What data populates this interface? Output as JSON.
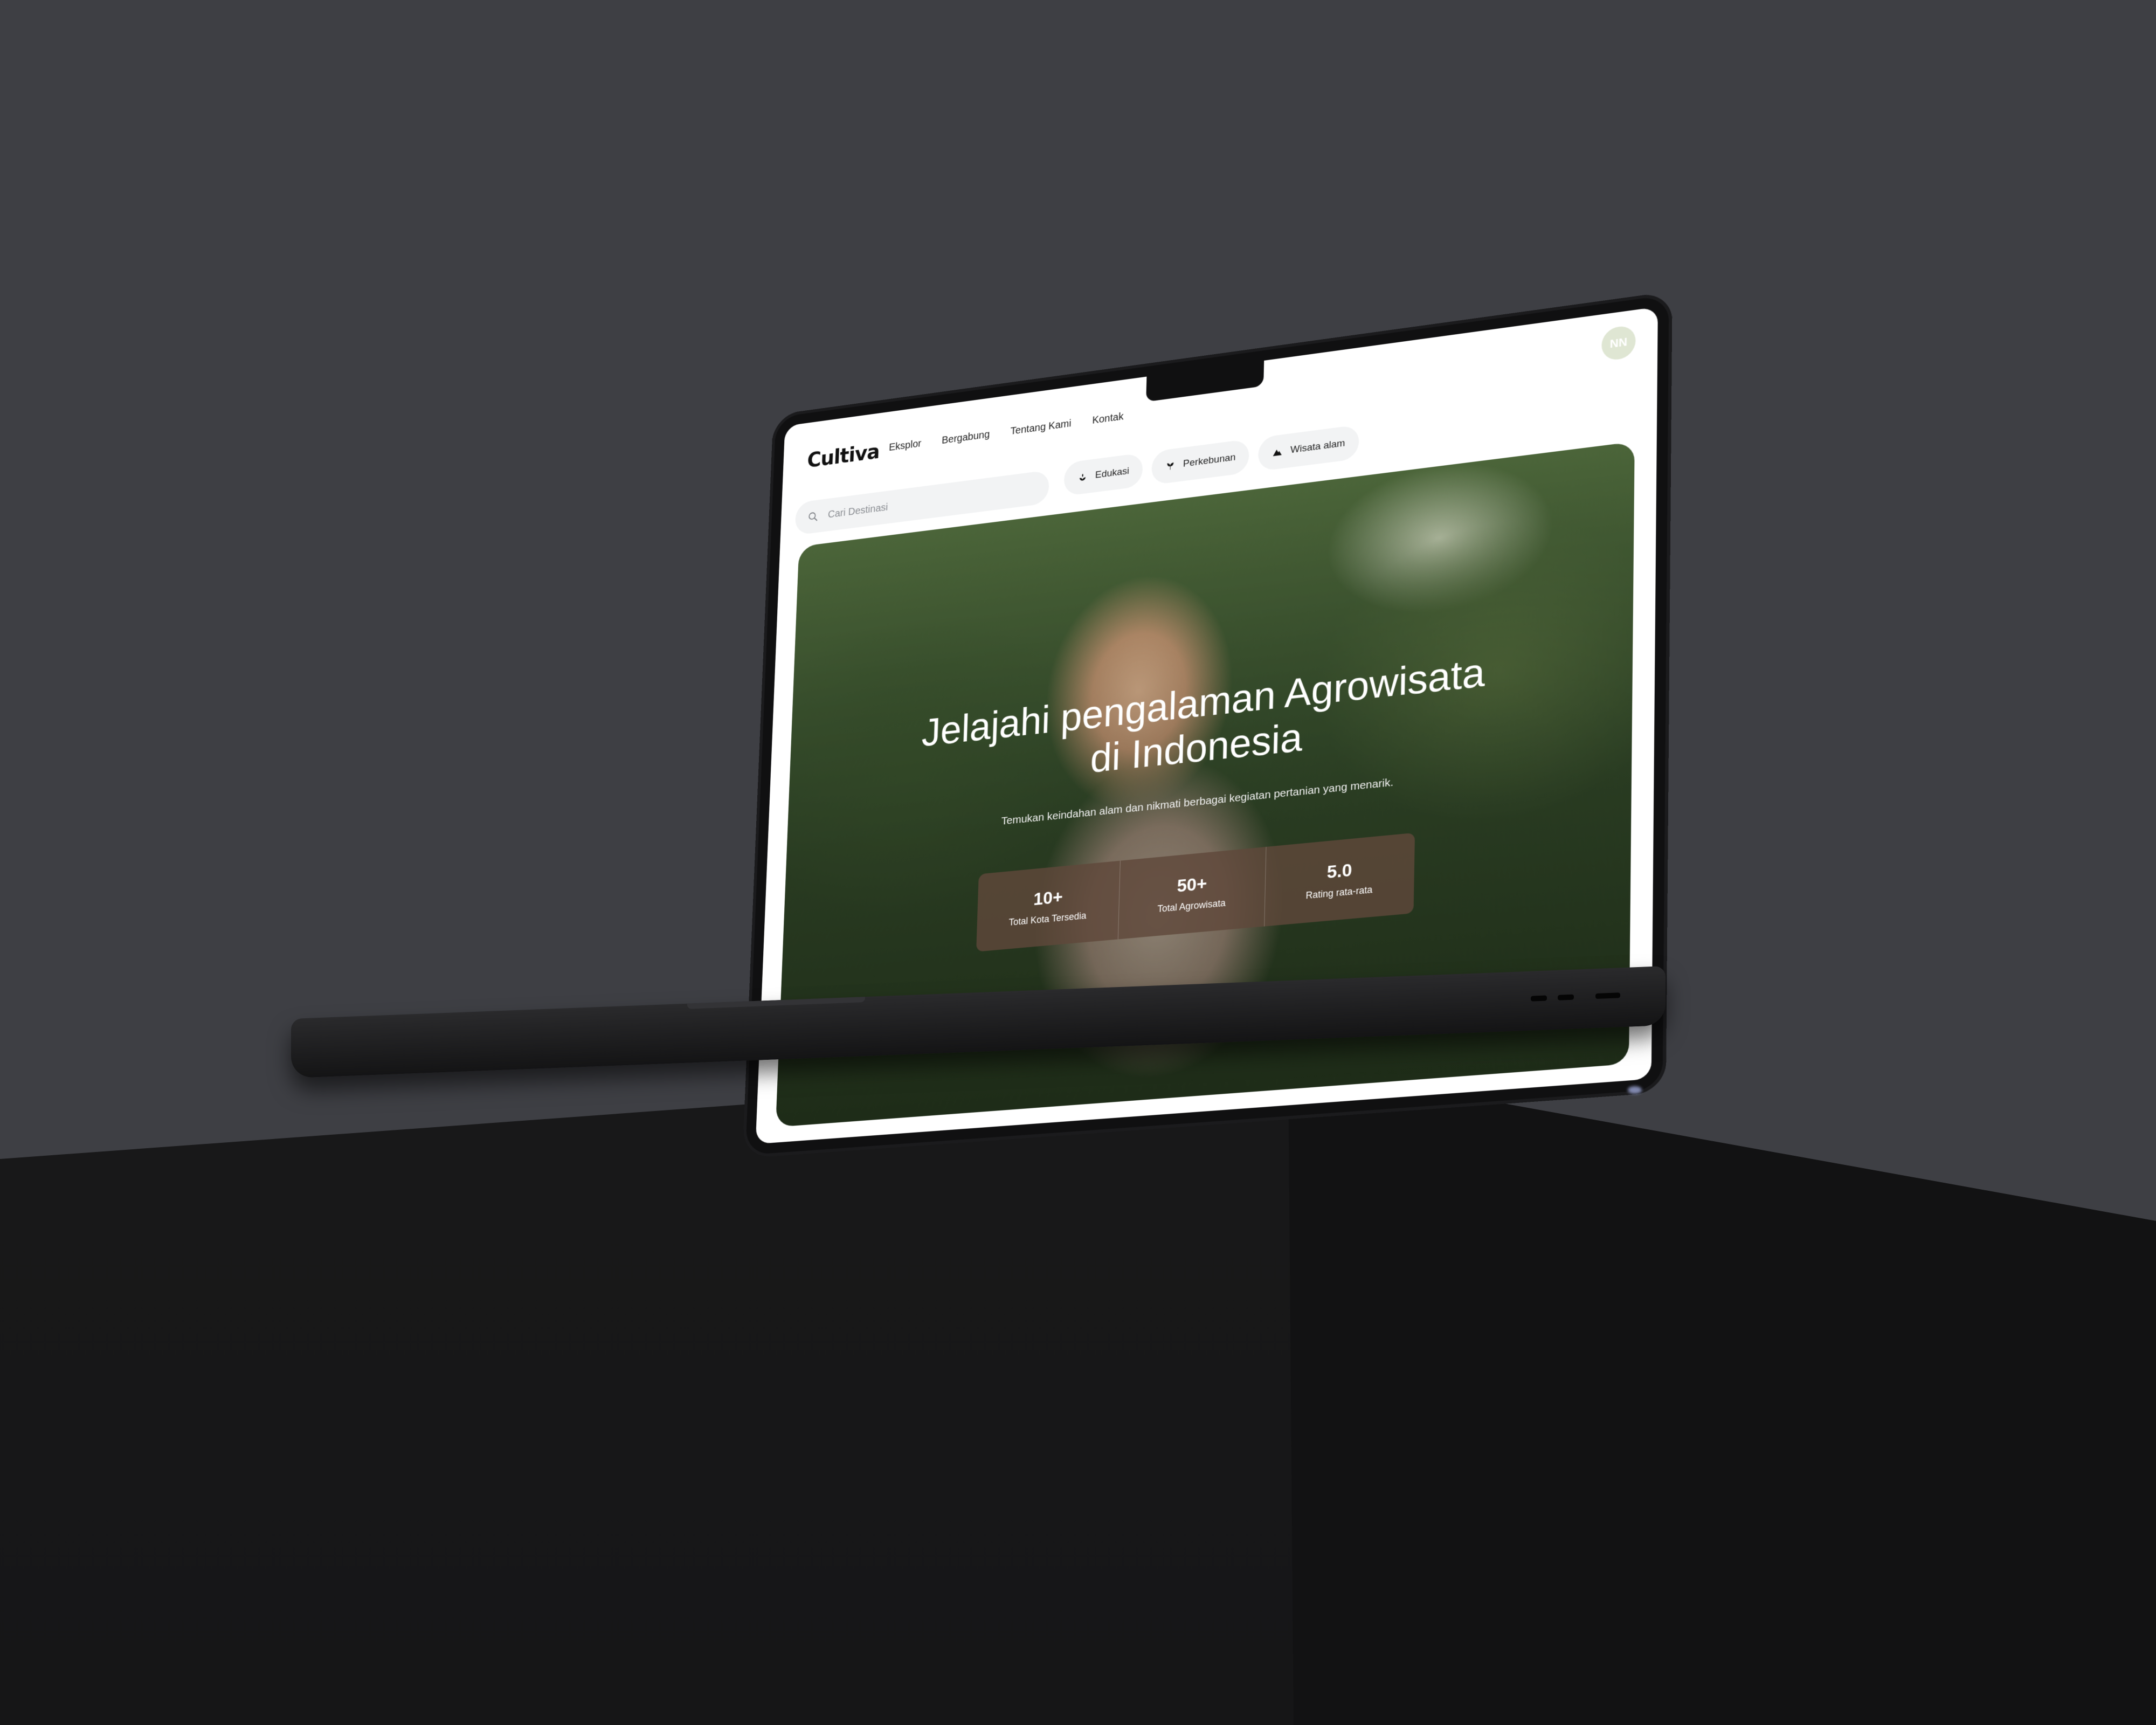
{
  "app": {
    "logo": "Cultiva"
  },
  "nav": {
    "items": [
      {
        "label": "Eksplor"
      },
      {
        "label": "Bergabung"
      },
      {
        "label": "Tentang Kami"
      },
      {
        "label": "Kontak"
      }
    ],
    "avatar_initials": "NN"
  },
  "search": {
    "placeholder": "Cari Destinasi",
    "icon": "search-icon"
  },
  "categories": [
    {
      "label": "Edukasi",
      "icon": "plant-icon"
    },
    {
      "label": "Perkebunan",
      "icon": "sprout-icon"
    },
    {
      "label": "Wisata alam",
      "icon": "mountain-icon"
    }
  ],
  "hero": {
    "title": "Jelajahi pengalaman Agrowisata di Indonesia",
    "subtitle": "Temukan keindahan alam dan nikmati berbagai kegiatan pertanian yang menarik.",
    "stats": [
      {
        "value": "10+",
        "label": "Total Kota Tersedia"
      },
      {
        "value": "50+",
        "label": "Total Agrowisata"
      },
      {
        "value": "5.0",
        "label": "Rating rata-rata"
      }
    ]
  },
  "colors": {
    "background": "#3e3f44",
    "pedestal": "#1c1c1d",
    "chip_bg": "#f2f3f4",
    "stats_bg": "#5f483a",
    "avatar_bg": "#dfe6d3"
  }
}
